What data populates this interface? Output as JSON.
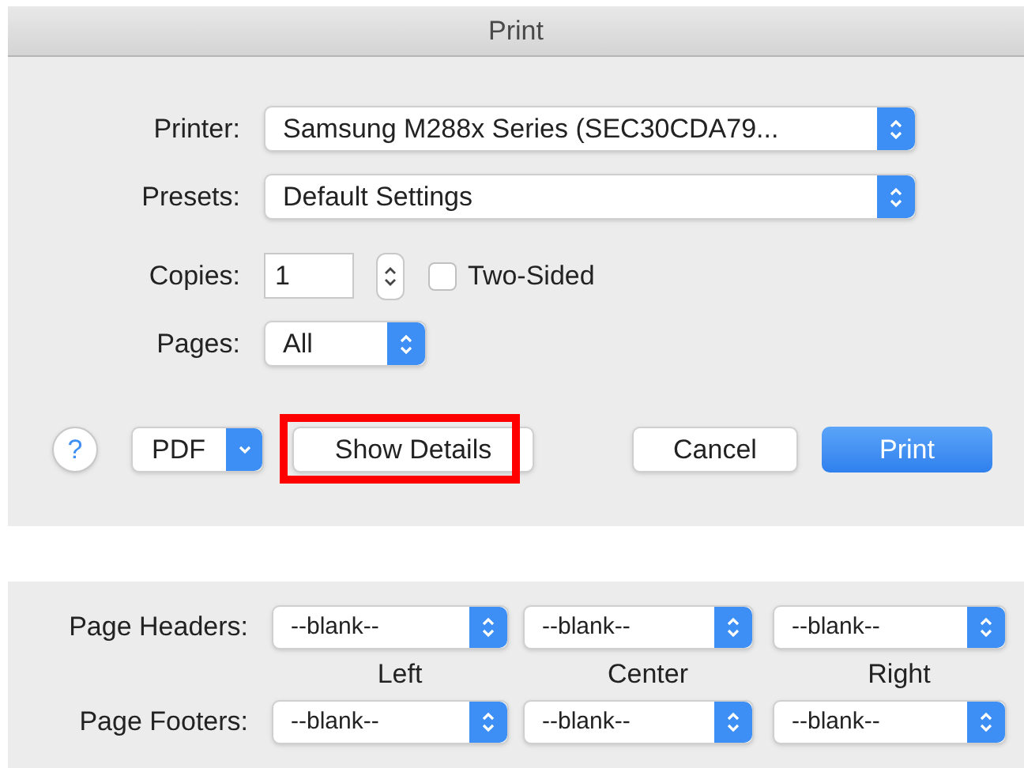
{
  "window": {
    "title": "Print"
  },
  "printer": {
    "label": "Printer:",
    "value": "Samsung M288x Series (SEC30CDA79..."
  },
  "presets": {
    "label": "Presets:",
    "value": "Default Settings"
  },
  "copies": {
    "label": "Copies:",
    "value": "1"
  },
  "two_sided": {
    "label": "Two-Sided",
    "checked": false
  },
  "pages": {
    "label": "Pages:",
    "value": "All"
  },
  "buttons": [
    {
      "kind": "help",
      "label": "?",
      "highlighted": false
    },
    {
      "kind": "menu",
      "label": "PDF",
      "highlighted": false
    },
    {
      "kind": "plain",
      "label": "Show Details",
      "highlighted": true
    },
    {
      "kind": "plain",
      "label": "Cancel",
      "highlighted": false
    },
    {
      "kind": "default",
      "label": "Print",
      "highlighted": false
    }
  ],
  "header_footer": {
    "headers_label": "Page Headers:",
    "footers_label": "Page Footers:",
    "columns": [
      "Left",
      "Center",
      "Right"
    ],
    "headers": [
      "--blank--",
      "--blank--",
      "--blank--"
    ],
    "footers": [
      "--blank--",
      "--blank--",
      "--blank--"
    ]
  }
}
